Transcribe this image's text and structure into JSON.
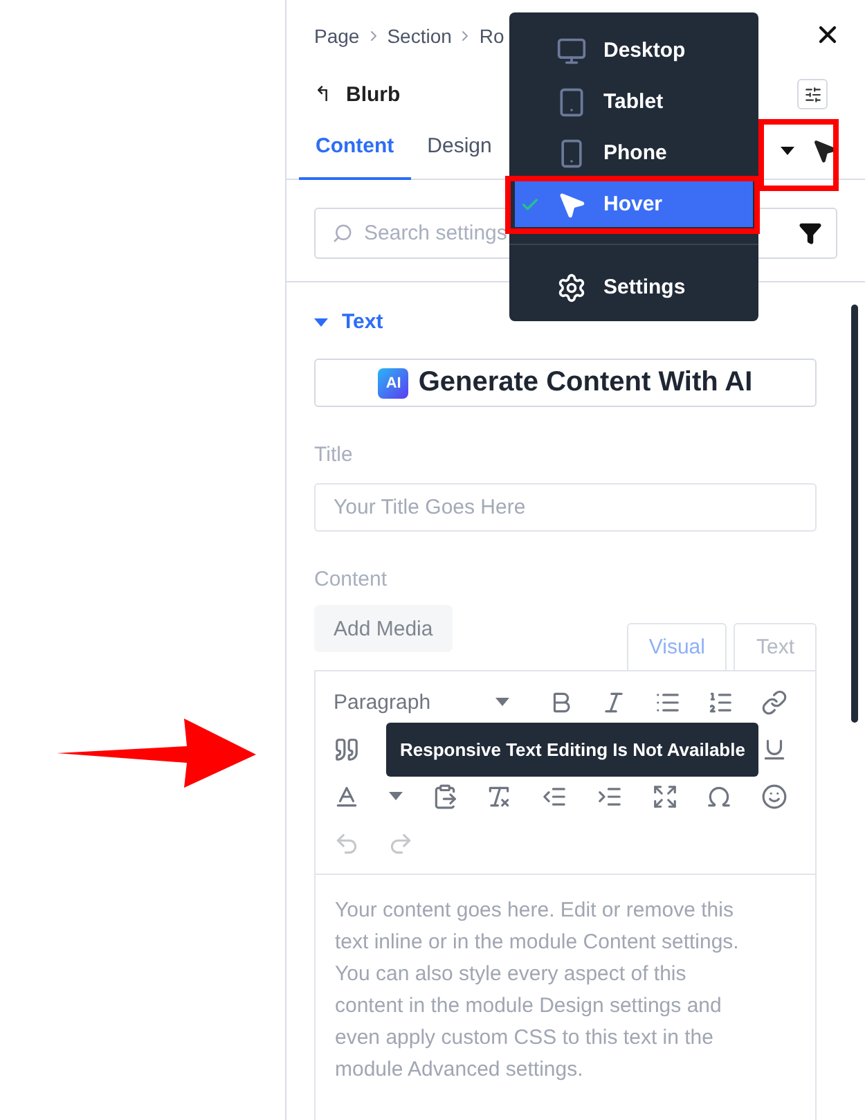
{
  "breadcrumb": [
    {
      "label": "Page"
    },
    {
      "label": "Section"
    },
    {
      "label": "Ro"
    }
  ],
  "module": {
    "back_icon": "↰",
    "title": "Blurb"
  },
  "tabs": [
    {
      "label": "Content",
      "selected": true
    },
    {
      "label": "Design",
      "selected": false
    }
  ],
  "search": {
    "placeholder": "Search settings"
  },
  "view_menu": [
    {
      "kind": "desktop",
      "label": "Desktop",
      "selected": false
    },
    {
      "kind": "tablet",
      "label": "Tablet",
      "selected": false
    },
    {
      "kind": "phone",
      "label": "Phone",
      "selected": false
    },
    {
      "kind": "hover",
      "label": "Hover",
      "selected": true
    },
    {
      "kind": "settings",
      "label": "Settings",
      "selected": false
    }
  ],
  "section": {
    "title": "Text",
    "expanded": true
  },
  "ai_button": {
    "label": "Generate Content With AI",
    "badge": "AI"
  },
  "title_field": {
    "label": "Title",
    "placeholder": "Your Title Goes Here"
  },
  "content_field": {
    "label": "Content",
    "add_media": "Add Media",
    "editor_tabs": [
      {
        "label": "Visual",
        "selected": true
      },
      {
        "label": "Text",
        "selected": false
      }
    ],
    "format": "Paragraph",
    "tooltip": "Responsive Text Editing Is Not Available",
    "body": "Your content goes here. Edit or remove this text inline or in the module Content settings. You can also style every aspect of this content in the module Design settings and even apply custom CSS to this text in the module Advanced settings."
  }
}
